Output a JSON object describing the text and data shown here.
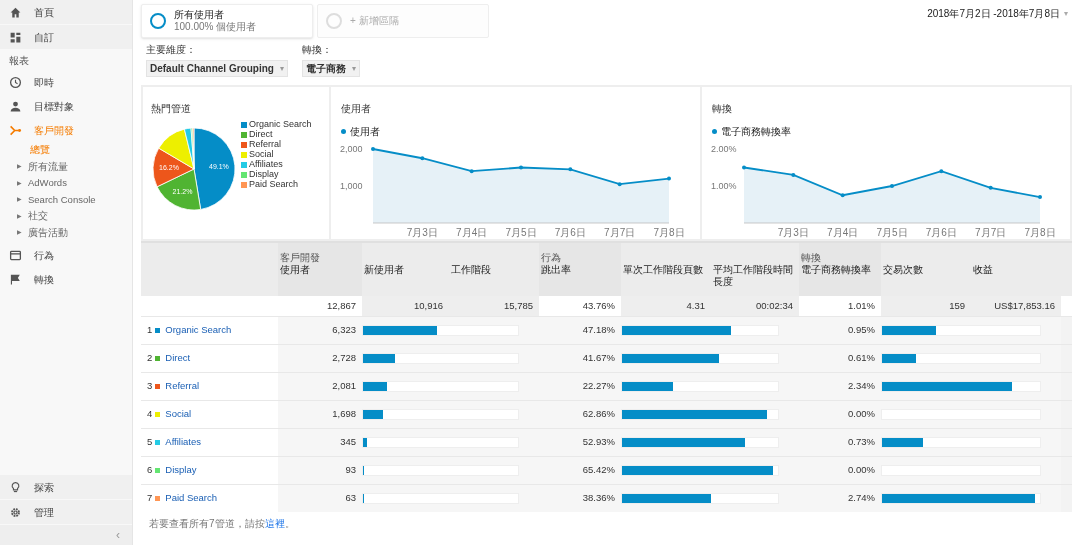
{
  "sidebar": {
    "top_items": [
      {
        "label": "首頁"
      },
      {
        "label": "自訂"
      }
    ],
    "section_label": "報表",
    "items": [
      {
        "label": "即時",
        "selected": false
      },
      {
        "label": "目標對象",
        "selected": false
      },
      {
        "label": "客戶開發",
        "selected": true,
        "children": [
          {
            "label": "總覽",
            "selected": true
          },
          {
            "label": "所有流量",
            "selected": false,
            "marker": "▶"
          },
          {
            "label": "AdWords",
            "selected": false,
            "marker": "▶"
          },
          {
            "label": "Search Console",
            "selected": false,
            "marker": "▶"
          },
          {
            "label": "社交",
            "selected": false,
            "marker": "▶"
          },
          {
            "label": "廣告活動",
            "selected": false,
            "marker": "▶"
          }
        ]
      },
      {
        "label": "行為",
        "selected": false
      },
      {
        "label": "轉換",
        "selected": false
      }
    ],
    "bottom_items": [
      {
        "label": "探索"
      },
      {
        "label": "管理"
      }
    ],
    "collapse": "‹"
  },
  "segments": [
    {
      "title": "所有使用者",
      "subtitle": "100.00% 個使用者",
      "active": true
    },
    {
      "title": "+ 新增區隔",
      "active": false
    }
  ],
  "date_range": "2018年7月2日 -2018年7月8日",
  "date_caret": "▾",
  "selectors": [
    {
      "label": "主要維度：",
      "value": "Default Channel Grouping",
      "caret": "▾"
    },
    {
      "label": "轉換：",
      "value": "電子商務",
      "caret": "▾"
    }
  ],
  "pie_panel": {
    "title": "熱門管道",
    "chart_data": {
      "type": "pie",
      "categories": [
        "Organic Search",
        "Direct",
        "Referral",
        "Social",
        "Affiliates",
        "Display",
        "Paid Search"
      ],
      "values": [
        49.1,
        21.2,
        16.2,
        13.2,
        2.7,
        0.7,
        0.5
      ],
      "colors": [
        "#058dc7",
        "#50b432",
        "#ed561b",
        "#edef00",
        "#24cbe5",
        "#64e572",
        "#ff9655"
      ],
      "value_labels": [
        "49.1%",
        "21.2%",
        "16.2%",
        null,
        null,
        null,
        null
      ],
      "legend": "right"
    }
  },
  "line_panels": [
    {
      "title": "使用者",
      "chart_data": {
        "type": "area",
        "categories": [
          null,
          "7月3日",
          "7月4日",
          "7月5日",
          "7月6日",
          "7月7日",
          "7月8日"
        ],
        "series": [
          {
            "name": "使用者",
            "color": "#058dc7",
            "values": [
              2000,
              1750,
              1400,
              1500,
              1450,
              1050,
              1200
            ]
          }
        ],
        "ylim": [
          0,
          2000
        ],
        "yticks": [
          {
            "value": 2000,
            "label": "2,000"
          },
          {
            "value": 1000,
            "label": "1,000"
          }
        ]
      }
    },
    {
      "title": "轉換",
      "chart_data": {
        "type": "area",
        "categories": [
          null,
          "7月3日",
          "7月4日",
          "7月5日",
          "7月6日",
          "7月7日",
          "7月8日"
        ],
        "series": [
          {
            "name": "電子商務轉換率",
            "color": "#058dc7",
            "values": [
              1.5,
              1.3,
              0.75,
              1.0,
              1.4,
              0.95,
              0.7
            ]
          }
        ],
        "ylim": [
          0,
          2
        ],
        "yticks": [
          {
            "value": 2,
            "label": "2.00%"
          },
          {
            "value": 1,
            "label": "1.00%"
          }
        ]
      }
    }
  ],
  "table": {
    "groups": [
      {
        "title": "客戶開發",
        "columns": [
          "使用者",
          "新使用者",
          "工作階段"
        ],
        "totals": [
          "12,867",
          "10,916",
          "15,785"
        ]
      },
      {
        "title": "行為",
        "columns": [
          "跳出率",
          "單次工作階段頁數",
          "平均工作階段時間長度"
        ],
        "totals": [
          "43.76%",
          "4.31",
          "00:02:34"
        ]
      },
      {
        "title": "轉換",
        "columns": [
          "電子商務轉換率",
          "交易次數",
          "收益"
        ],
        "totals": [
          "1.01%",
          "159",
          "US$17,853.16"
        ]
      }
    ],
    "rows": [
      {
        "rank": "1",
        "color": "#058dc7",
        "channel": "Organic Search",
        "cells": [
          {
            "value": "6,323",
            "level": 0.49
          },
          {
            "value": "47.18%",
            "level": 0.72
          },
          {
            "value": "0.95%",
            "level": 0.35
          }
        ]
      },
      {
        "rank": "2",
        "color": "#50b432",
        "channel": "Direct",
        "cells": [
          {
            "value": "2,728",
            "level": 0.21
          },
          {
            "value": "41.67%",
            "level": 0.64
          },
          {
            "value": "0.61%",
            "level": 0.22
          }
        ]
      },
      {
        "rank": "3",
        "color": "#ed561b",
        "channel": "Referral",
        "cells": [
          {
            "value": "2,081",
            "level": 0.16
          },
          {
            "value": "22.27%",
            "level": 0.34
          },
          {
            "value": "2.34%",
            "level": 0.85
          }
        ]
      },
      {
        "rank": "4",
        "color": "#edef00",
        "channel": "Social",
        "cells": [
          {
            "value": "1,698",
            "level": 0.13
          },
          {
            "value": "62.86%",
            "level": 0.96
          },
          {
            "value": "0.00%",
            "level": 0
          }
        ]
      },
      {
        "rank": "5",
        "color": "#24cbe5",
        "channel": "Affiliates",
        "cells": [
          {
            "value": "345",
            "level": 0.027
          },
          {
            "value": "52.93%",
            "level": 0.81
          },
          {
            "value": "0.73%",
            "level": 0.27
          }
        ]
      },
      {
        "rank": "6",
        "color": "#64e572",
        "channel": "Display",
        "cells": [
          {
            "value": "93",
            "level": 0.007
          },
          {
            "value": "65.42%",
            "level": 1
          },
          {
            "value": "0.00%",
            "level": 0
          }
        ]
      },
      {
        "rank": "7",
        "color": "#ff9655",
        "channel": "Paid Search",
        "cells": [
          {
            "value": "63",
            "level": 0.005
          },
          {
            "value": "38.36%",
            "level": 0.59
          },
          {
            "value": "2.74%",
            "level": 1
          }
        ]
      }
    ]
  },
  "footer": {
    "before": "若要查看所有7管道，請按",
    "link": "這裡",
    "after": "。"
  }
}
